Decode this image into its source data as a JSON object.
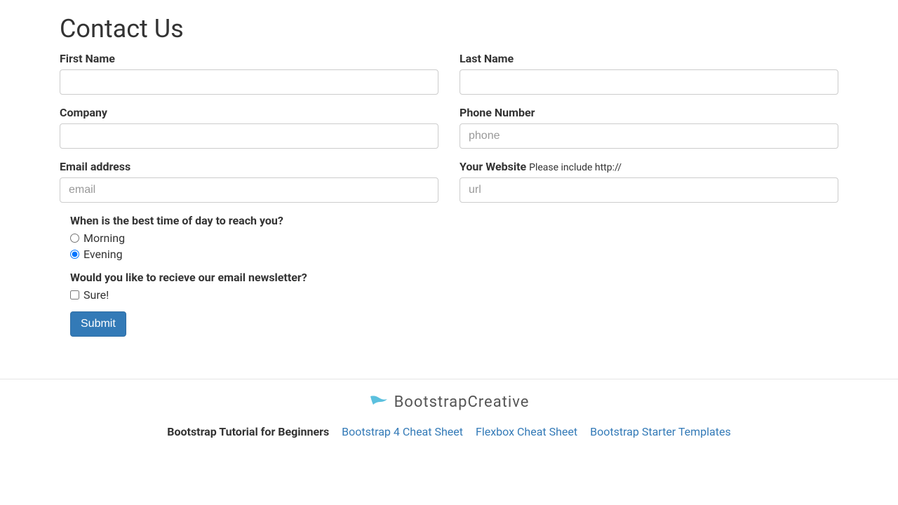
{
  "page": {
    "title": "Contact Us"
  },
  "form": {
    "first_name": {
      "label": "First Name",
      "value": "",
      "placeholder": ""
    },
    "last_name": {
      "label": "Last Name",
      "value": "",
      "placeholder": ""
    },
    "company": {
      "label": "Company",
      "value": "",
      "placeholder": ""
    },
    "phone": {
      "label": "Phone Number",
      "value": "",
      "placeholder": "phone"
    },
    "email": {
      "label": "Email address",
      "value": "",
      "placeholder": "email"
    },
    "website": {
      "label": "Your Website ",
      "hint": "Please include http://",
      "value": "",
      "placeholder": "url"
    },
    "best_time": {
      "question": "When is the best time of day to reach you?",
      "options": [
        {
          "label": "Morning",
          "selected": false
        },
        {
          "label": "Evening",
          "selected": true
        }
      ]
    },
    "newsletter": {
      "question": "Would you like to recieve our email newsletter?",
      "option": {
        "label": "Sure!",
        "checked": false
      }
    },
    "submit_label": "Submit"
  },
  "footer": {
    "logo_text": "BootstrapCreative",
    "links": [
      {
        "label": "Bootstrap Tutorial for Beginners",
        "active": true
      },
      {
        "label": "Bootstrap 4 Cheat Sheet",
        "active": false
      },
      {
        "label": "Flexbox Cheat Sheet",
        "active": false
      },
      {
        "label": "Bootstrap Starter Templates",
        "active": false
      }
    ]
  }
}
